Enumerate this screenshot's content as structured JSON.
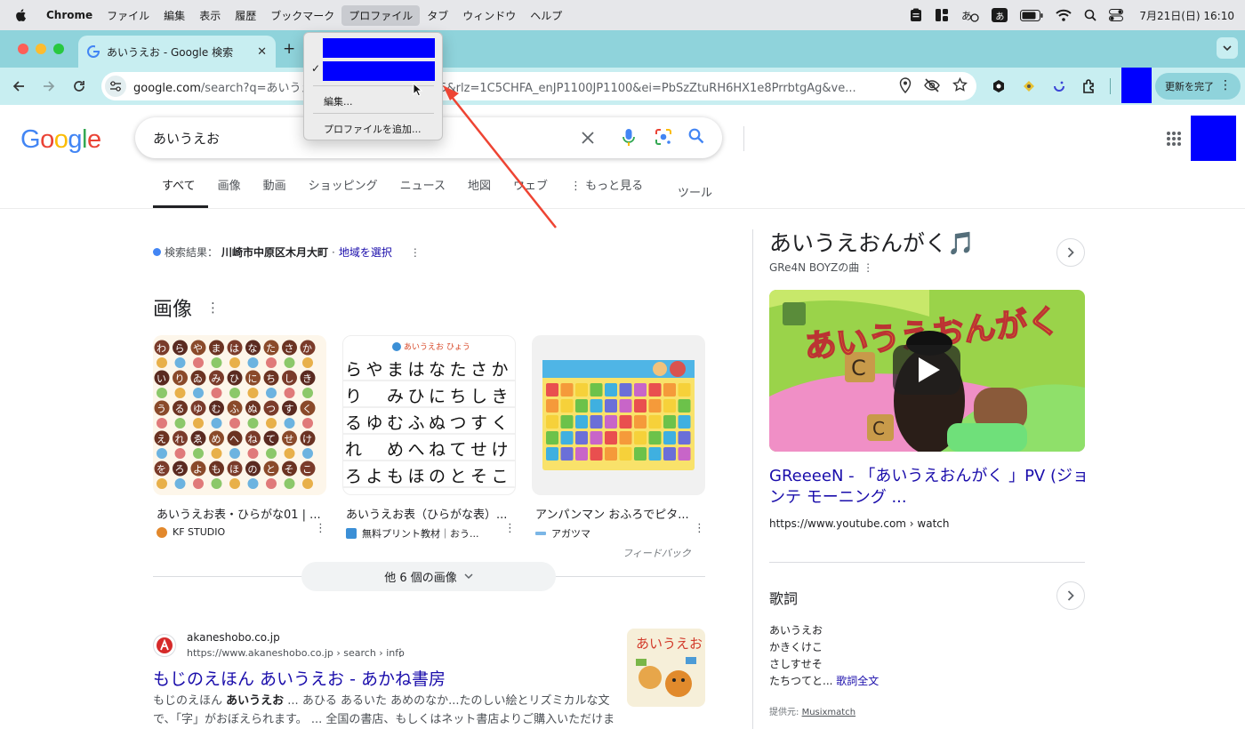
{
  "menubar": {
    "app_name": "Chrome",
    "items": [
      "ファイル",
      "編集",
      "表示",
      "履歴",
      "ブックマーク",
      "プロファイル",
      "タブ",
      "ウィンドウ",
      "ヘルプ"
    ],
    "ime": "あ",
    "clock": "7月21日(日)  16:10"
  },
  "browser": {
    "tab_title": "あいうえお - Google 検索",
    "tab_close": "✕",
    "newtab": "+",
    "url_host": "google.com",
    "url_rest": "/search?q=あいうえお&sca_esv=d172d725&rlz=1C5CHFA_enJP1100JP1100&ei=PbSzZtuRH6HX1e8PrrbtgAg&ve...",
    "update_button": "更新を完了"
  },
  "profile_menu": {
    "edit": "編集...",
    "add_profile": "プロファイルを追加...",
    "check": "✓"
  },
  "google": {
    "logo": [
      "G",
      "o",
      "o",
      "g",
      "l",
      "e"
    ],
    "query": "あいうえお",
    "nav_tabs": [
      "すべて",
      "画像",
      "動画",
      "ショッピング",
      "ニュース",
      "地図",
      "ウェブ",
      "⋮ もっと見る"
    ],
    "tools": "ツール"
  },
  "location": {
    "label": "検索結果：",
    "place": "川崎市中原区木月大町",
    "sep": "·",
    "link": "地域を選択"
  },
  "images": {
    "heading": "画像",
    "cards": [
      {
        "caption": "あいうえお表・ひらがな01 | ...",
        "source": "KF STUDIO"
      },
      {
        "caption": "あいうえお表（ひらがな表）...",
        "source": "無料プリント教材｜おう..."
      },
      {
        "caption": "アンパンマン おふろでピタ...",
        "source": "アガツマ"
      }
    ],
    "thumb2_header": "あいうえお ひょう",
    "thumb1_rows": [
      "わらやまはなたさか",
      "いりゐみひにちしき",
      "うるゆむふぬつすく",
      "えれゑめへねてせけ",
      "をろよもほのとそこ"
    ],
    "thumb2_rows": [
      "らやまはなたさか",
      "り　みひにちしき",
      "るゆむふぬつすく",
      "れ　めへねてせけ",
      "ろよもほのとそこ"
    ],
    "feedback": "フィードバック",
    "more": "他 6 個の画像"
  },
  "result": {
    "site": "akaneshobo.co.jp",
    "crumb": "https://www.akaneshobo.co.jp › search › info",
    "title": "もじのえほん あいうえお - あかね書房",
    "snippet_pre": "もじのえほん ",
    "snippet_bold": "あいうえお",
    "snippet_post": " ... あひる あるいた あめのなか...たのしい絵とリズミカルな文で、「字」がおぼえられます。 ... 全国の書店、もしくはネット書店よりご購入いただけます。",
    "thumb_text": "あいうえお"
  },
  "knowledge_panel": {
    "title": "あいうえおんがく🎵",
    "subtitle": "GRe4N BOYZの曲 ⋮",
    "video_text": "あいうえおんがく",
    "video_title": "GReeeeN - 「あいうえおんがく 」PV (ジョンテ モーニング ...",
    "video_url": "https://www.youtube.com › watch",
    "lyrics_heading": "歌詞",
    "lyrics_lines": [
      "あいうえお",
      "かきくけこ",
      "さしすせそ",
      "たちつてと..."
    ],
    "lyrics_full": "歌詞全文",
    "provider_label": "提供元: ",
    "provider": "Musixmatch"
  },
  "colors": {
    "chrome_frame": "#8fd3db",
    "chrome_toolbar": "#c8eef1",
    "redaction": "#0000ff",
    "link": "#1a0dab",
    "annotation_arrow": "#ee4433"
  },
  "icons": [
    "apple-icon",
    "clipboard-icon",
    "window-layout-icon",
    "battery-icon",
    "wifi-icon",
    "spotlight-icon",
    "control-center-icon",
    "google-favicon",
    "back-icon",
    "forward-icon",
    "reload-icon",
    "site-info-icon",
    "location-icon",
    "eye-off-icon",
    "star-icon",
    "extension-icon",
    "kebab-icon",
    "clear-icon",
    "mic-icon",
    "lens-icon",
    "search-icon",
    "apps-grid-icon",
    "chevron-right-icon",
    "chevron-down-icon",
    "play-icon"
  ]
}
